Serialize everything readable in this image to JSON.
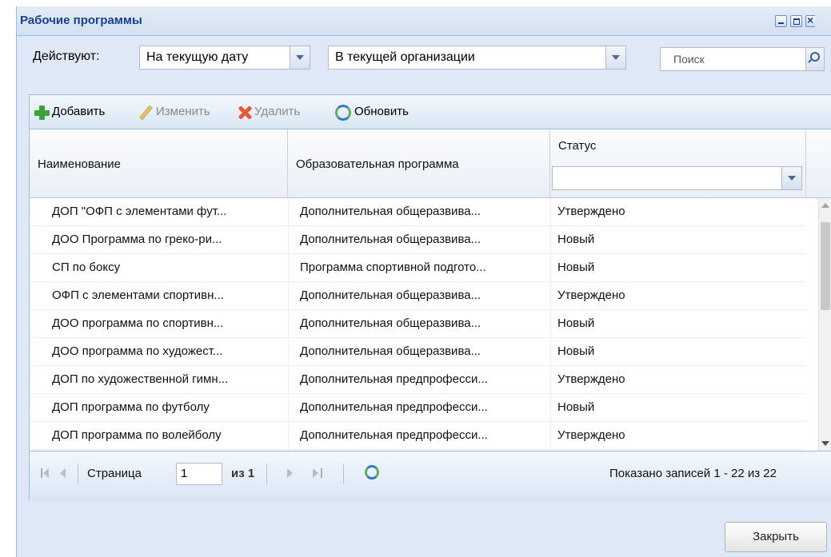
{
  "window": {
    "title": "Рабочие программы"
  },
  "filters": {
    "label": "Действуют:",
    "date_value": "На текущую дату",
    "org_value": "В текущей организации",
    "search_placeholder": "Поиск"
  },
  "toolbar": {
    "add": "Добавить",
    "edit": "Изменить",
    "delete": "Удалить",
    "refresh": "Обновить"
  },
  "grid": {
    "columns": {
      "name": "Наименование",
      "program": "Образовательная программа",
      "status": "Статус",
      "status_filter_value": ""
    },
    "rows": [
      {
        "name": "ДОП \"ОФП с элементами фут...",
        "program": "Дополнительная общеразвива...",
        "status": "Утверждено"
      },
      {
        "name": "ДОО Программа по греко-ри...",
        "program": "Дополнительная общеразвива...",
        "status": "Новый"
      },
      {
        "name": "СП по боксу",
        "program": "Программа спортивной подгото...",
        "status": "Новый"
      },
      {
        "name": "ОФП с элементами спортивн...",
        "program": "Дополнительная общеразвива...",
        "status": "Утверждено"
      },
      {
        "name": "ДОО программа по спортивн...",
        "program": "Дополнительная общеразвива...",
        "status": "Новый"
      },
      {
        "name": "ДОО программа по художест...",
        "program": "Дополнительная общеразвива...",
        "status": "Новый"
      },
      {
        "name": "ДОП по художественной гимн...",
        "program": "Дополнительная предпрофесси...",
        "status": "Утверждено"
      },
      {
        "name": "ДОП программа по футболу",
        "program": "Дополнительная предпрофесси...",
        "status": "Новый"
      },
      {
        "name": "ДОП программа по волейболу",
        "program": "Дополнительная предпрофесси...",
        "status": "Утверждено"
      }
    ]
  },
  "pager": {
    "page_label": "Страница",
    "page_value": "1",
    "of_label": "из 1",
    "records_text": "Показано записей 1 - 22 из 22"
  },
  "footer": {
    "close": "Закрыть"
  }
}
